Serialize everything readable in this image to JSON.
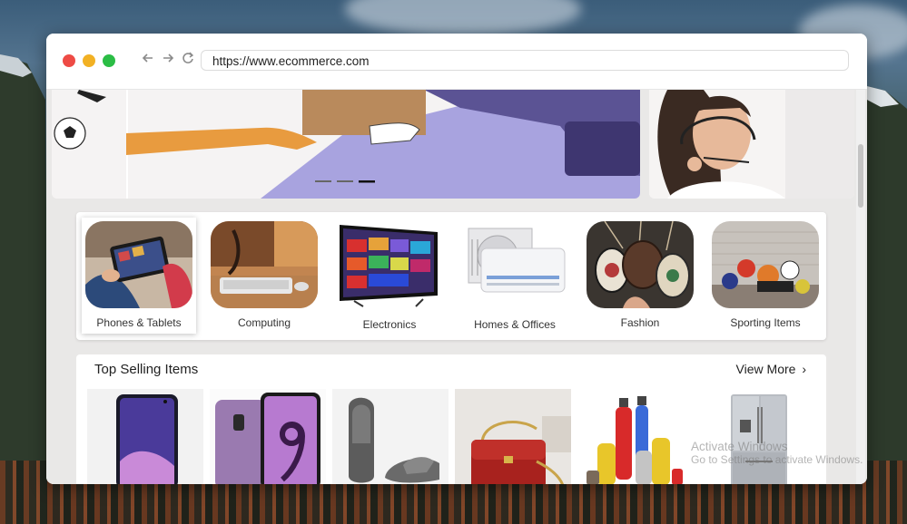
{
  "browser": {
    "url": "https://www.ecommerce.com",
    "nav_icons": [
      "back-arrow-icon",
      "forward-arrow-icon",
      "reload-icon"
    ],
    "traffic_light_colors": [
      "#ee4b45",
      "#f2b124",
      "#2bbd45"
    ]
  },
  "hero": {
    "carousel_indicator_count": 3,
    "active_indicator": 3
  },
  "categories": [
    {
      "label": "Phones & Tablets"
    },
    {
      "label": "Computing"
    },
    {
      "label": "Electronics"
    },
    {
      "label": "Homes & Offices"
    },
    {
      "label": "Fashion"
    },
    {
      "label": "Sporting Items"
    }
  ],
  "top_selling": {
    "title": "Top Selling Items",
    "view_more": "View More",
    "view_more_icon": "chevron-right-icon"
  },
  "watermark": {
    "line1": "Activate Windows",
    "line2": "Go to Settings to activate Windows."
  }
}
